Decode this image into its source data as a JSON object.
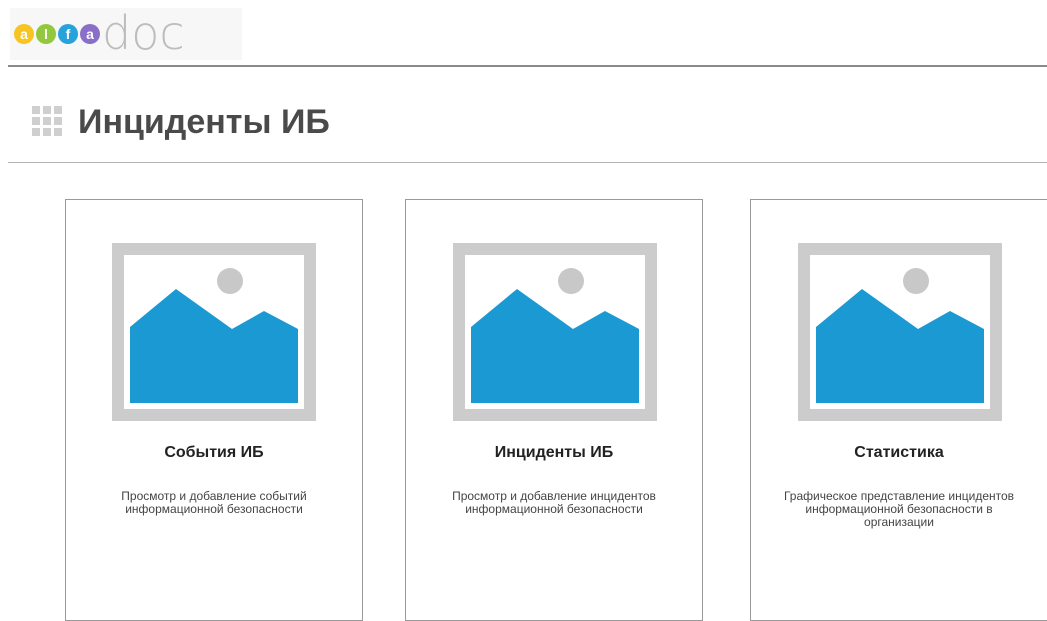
{
  "logo": {
    "letters": [
      "a",
      "l",
      "f",
      "a"
    ],
    "word": "doc",
    "colors": [
      "#f6c523",
      "#93c83e",
      "#27a2db",
      "#8a6fc9"
    ]
  },
  "header": {
    "title": "Инциденты ИБ",
    "icon": "grid-icon"
  },
  "cards": [
    {
      "title": "События ИБ",
      "description": "Просмотр и добавление событий информационной безопасности",
      "image": "image-placeholder-icon"
    },
    {
      "title": "Инциденты ИБ",
      "description": "Просмотр и добавление инцидентов информационной безопасности",
      "image": "image-placeholder-icon"
    },
    {
      "title": "Статистика",
      "description": "Графическое представление инцидентов информационной безопасности в организации",
      "image": "image-placeholder-icon"
    }
  ],
  "colors": {
    "placeholder_frame": "#cccccc",
    "placeholder_mountain": "#1a99d3",
    "placeholder_sun": "#c8c8c8"
  }
}
